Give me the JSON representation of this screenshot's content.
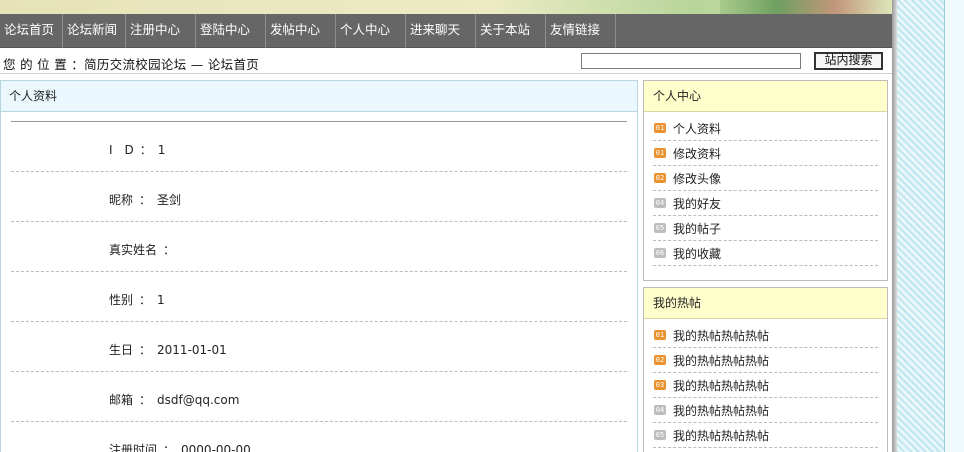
{
  "nav": {
    "items": [
      "论坛首页",
      "论坛新闻",
      "注册中心",
      "登陆中心",
      "发帖中心",
      "个人中心",
      "进来聊天",
      "关于本站",
      "友情链接"
    ]
  },
  "location": {
    "prefix": "您 的 位 置 ：",
    "site": "简历交流校园论坛",
    "separator": "—",
    "current": "论坛首页"
  },
  "search": {
    "value": "",
    "button_label": "站内搜索"
  },
  "profile": {
    "title": "个人资料",
    "rows": [
      {
        "label": "I　D",
        "value": "1"
      },
      {
        "label": "昵称",
        "value": "圣剑"
      },
      {
        "label": "真实姓名",
        "value": ""
      },
      {
        "label": "性别",
        "value": "1"
      },
      {
        "label": "生日",
        "value": "2011-01-01"
      },
      {
        "label": "邮箱",
        "value": "dsdf@qq.com"
      },
      {
        "label": "注册时间",
        "value": "0000-00-00"
      }
    ]
  },
  "user_center": {
    "title": "个人中心",
    "items": [
      {
        "icon": "01",
        "label": "个人资料"
      },
      {
        "icon": "01",
        "label": "修改资料"
      },
      {
        "icon": "02",
        "label": "修改头像"
      },
      {
        "icon": "04",
        "label": "我的好友"
      },
      {
        "icon": "05",
        "label": "我的帖子"
      },
      {
        "icon": "06",
        "label": "我的收藏"
      }
    ]
  },
  "hot_posts": {
    "title": "我的热帖",
    "items": [
      {
        "icon": "01",
        "label": "我的热帖热帖热帖"
      },
      {
        "icon": "02",
        "label": "我的热帖热帖热帖"
      },
      {
        "icon": "03",
        "label": "我的热帖热帖热帖"
      },
      {
        "icon": "04",
        "label": "我的热帖热帖热帖"
      },
      {
        "icon": "05",
        "label": "我的热帖热帖热帖"
      }
    ]
  },
  "colors": {
    "nav_bg": "#666666",
    "main_head_bg": "#eaf7fc",
    "panel_head_bg": "#ffffcc",
    "icon_active": "#e8932e",
    "icon_inactive": "#bdbdbd"
  }
}
